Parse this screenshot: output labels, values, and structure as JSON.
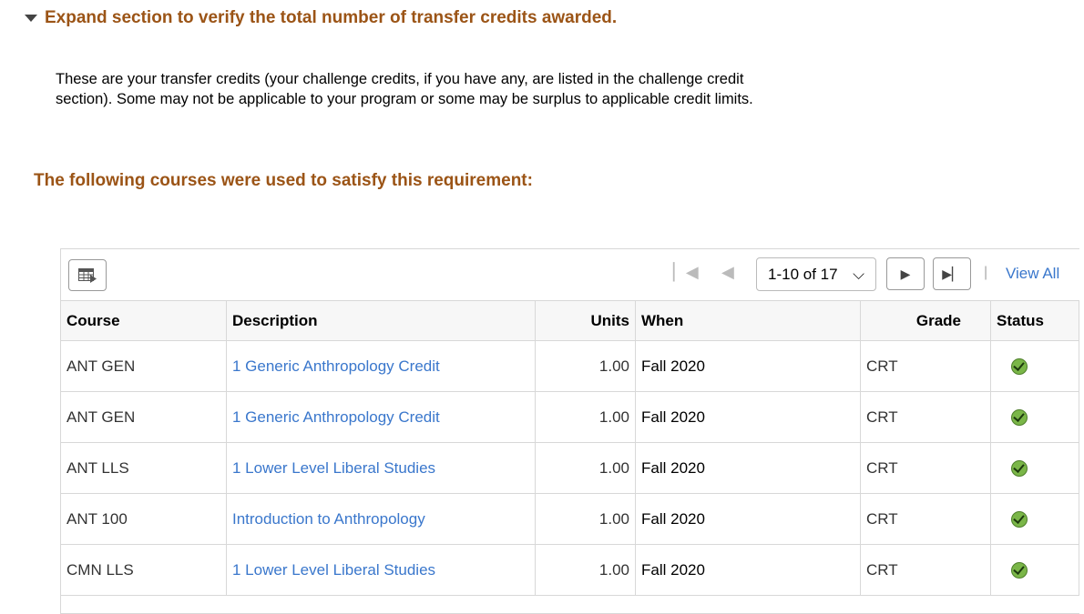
{
  "section": {
    "title": "Expand section to verify the total number of transfer credits awarded.",
    "intro": "These are your transfer credits (your challenge credits, if you have any, are listed in the challenge credit section). Some may not be applicable to your program or some may be surplus to applicable credit limits.",
    "requirement": "The following courses were used to satisfy this requirement:"
  },
  "grid": {
    "pager": "1-10 of 17",
    "view_all": "View All",
    "separator": "|",
    "columns": [
      "Course",
      "Description",
      "Units",
      "When",
      "Grade",
      "Status"
    ],
    "rows": [
      {
        "course": "ANT GEN",
        "description": "1 Generic Anthropology Credit",
        "units": "1.00",
        "when": "Fall 2020",
        "grade": "CRT",
        "status": "check-icon"
      },
      {
        "course": "ANT GEN",
        "description": "1 Generic Anthropology Credit",
        "units": "1.00",
        "when": "Fall 2020",
        "grade": "CRT",
        "status": "check-icon"
      },
      {
        "course": "ANT LLS",
        "description": "1 Lower Level Liberal Studies",
        "units": "1.00",
        "when": "Fall 2020",
        "grade": "CRT",
        "status": "check-icon"
      },
      {
        "course": "ANT 100",
        "description": "Introduction to Anthropology",
        "units": "1.00",
        "when": "Fall 2020",
        "grade": "CRT",
        "status": "check-icon"
      },
      {
        "course": "CMN LLS",
        "description": "1 Lower Level Liberal Studies",
        "units": "1.00",
        "when": "Fall 2020",
        "grade": "CRT",
        "status": "check-icon"
      }
    ]
  },
  "colors": {
    "heading": "#9b5416",
    "link": "#3a77cc",
    "check": "#7ab648"
  }
}
